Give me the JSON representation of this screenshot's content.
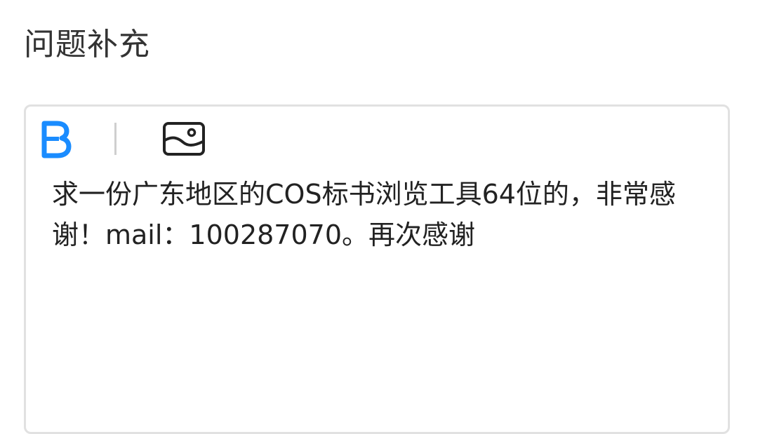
{
  "section": {
    "title": "问题补充"
  },
  "toolbar": {
    "bold_icon": "bold-icon",
    "image_icon": "image-icon",
    "accent_color": "#1a8cff"
  },
  "editor": {
    "content": "求一份广东地区的COS标书浏览工具64位的，非常感谢！mail：100287070。再次感谢"
  }
}
